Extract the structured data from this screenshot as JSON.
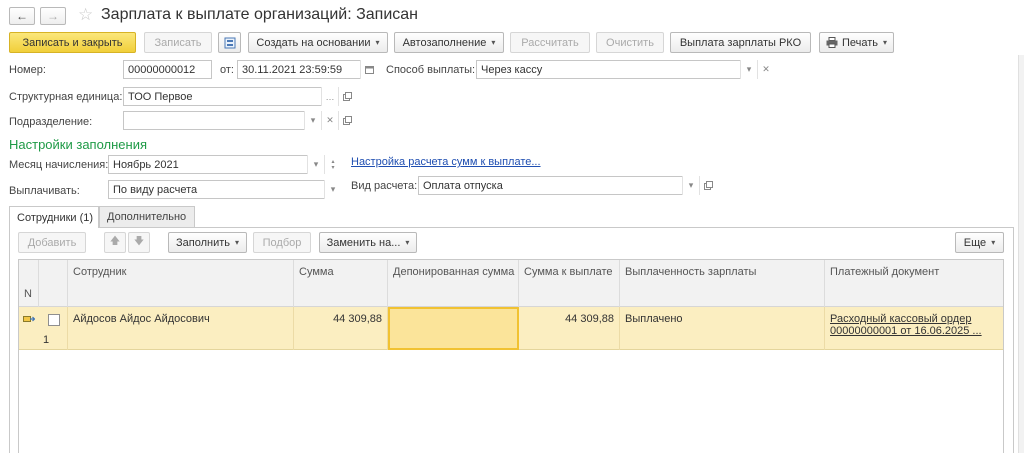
{
  "window": {
    "title": "Зарплата к выплате организаций: Записан"
  },
  "nav": {
    "back_glyph": "←",
    "forward_glyph": "→",
    "favorite_glyph": "☆"
  },
  "toolbar": {
    "save_close": "Записать и закрыть",
    "save": "Записать",
    "create_based_on": "Создать на основании",
    "autofill": "Автозаполнение",
    "calculate": "Рассчитать",
    "clear": "Очистить",
    "payment_rko": "Выплата зарплаты РКО",
    "print": "Печать",
    "caret": "▾"
  },
  "form": {
    "number_label": "Номер:",
    "number_value": "00000000012",
    "date_label": "от:",
    "date_value": "30.11.2021 23:59:59",
    "payment_method_label": "Способ выплаты:",
    "payment_method_value": "Через кассу",
    "org_unit_label": "Структурная единица:",
    "org_unit_value": "ТОО Первое",
    "department_label": "Подразделение:",
    "department_value": ""
  },
  "fill_settings": {
    "title": "Настройки заполнения",
    "month_label": "Месяц начисления:",
    "month_value": "Ноябрь 2021",
    "calc_settings_link": "Настройка расчета сумм к выплате...",
    "pay_label": "Выплачивать:",
    "pay_value": "По виду расчета",
    "calc_type_label": "Вид расчета:",
    "calc_type_value": "Оплата отпуска"
  },
  "tabs": [
    {
      "label": "Сотрудники (1)"
    },
    {
      "label": "Дополнительно"
    }
  ],
  "table_toolbar": {
    "add": "Добавить",
    "up_glyph": "🡅",
    "down_glyph": "🡇",
    "fill": "Заполнить",
    "selection": "Подбор",
    "replace": "Заменить на...",
    "more": "Еще"
  },
  "table": {
    "columns": {
      "n": "N",
      "employee": "Сотрудник",
      "amount": "Сумма",
      "deposited": "Депонированная сумма",
      "to_pay": "Сумма к выплате",
      "paid_status": "Выплаченность зарплаты",
      "payment_doc": "Платежный документ"
    },
    "rows": [
      {
        "n": "1",
        "employee": "Айдосов Айдос Айдосович",
        "amount": "44 309,88",
        "deposited": "",
        "to_pay": "44 309,88",
        "paid_status": "Выплачено",
        "payment_doc_line1": "Расходный кассовый ордер",
        "payment_doc_line2": "00000000001 от 16.06.2025 ..."
      }
    ]
  }
}
